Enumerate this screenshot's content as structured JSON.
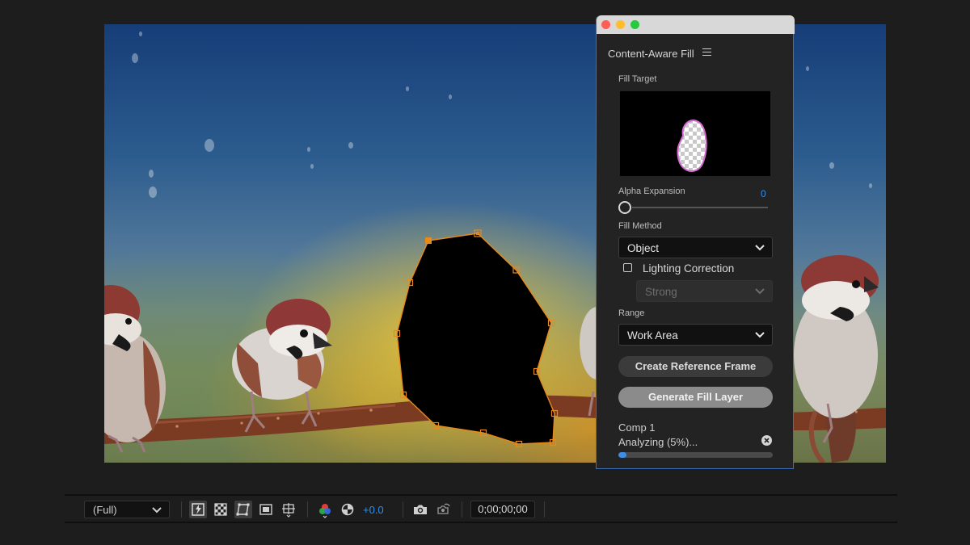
{
  "panel": {
    "title": "Content-Aware Fill",
    "fill_target_label": "Fill Target",
    "alpha_expansion_label": "Alpha Expansion",
    "alpha_expansion_value": "0",
    "alpha_expansion_fraction": 0,
    "fill_method_label": "Fill Method",
    "fill_method_value": "Object",
    "lighting_correction_label": "Lighting Correction",
    "lighting_correction_checked": false,
    "lighting_strength_value": "Strong",
    "range_label": "Range",
    "range_value": "Work Area",
    "create_reference_label": "Create Reference Frame",
    "generate_fill_label": "Generate Fill Layer",
    "comp_name": "Comp 1",
    "status": "Analyzing (5%)...",
    "progress_percent": 5
  },
  "toolbar": {
    "resolution": "(Full)",
    "exposure": "+0.0",
    "timecode": "0;00;00;00"
  },
  "colors": {
    "accent": "#2e8ff0",
    "panel_border": "#3e6fb5",
    "mask_path": "#e8891c"
  }
}
